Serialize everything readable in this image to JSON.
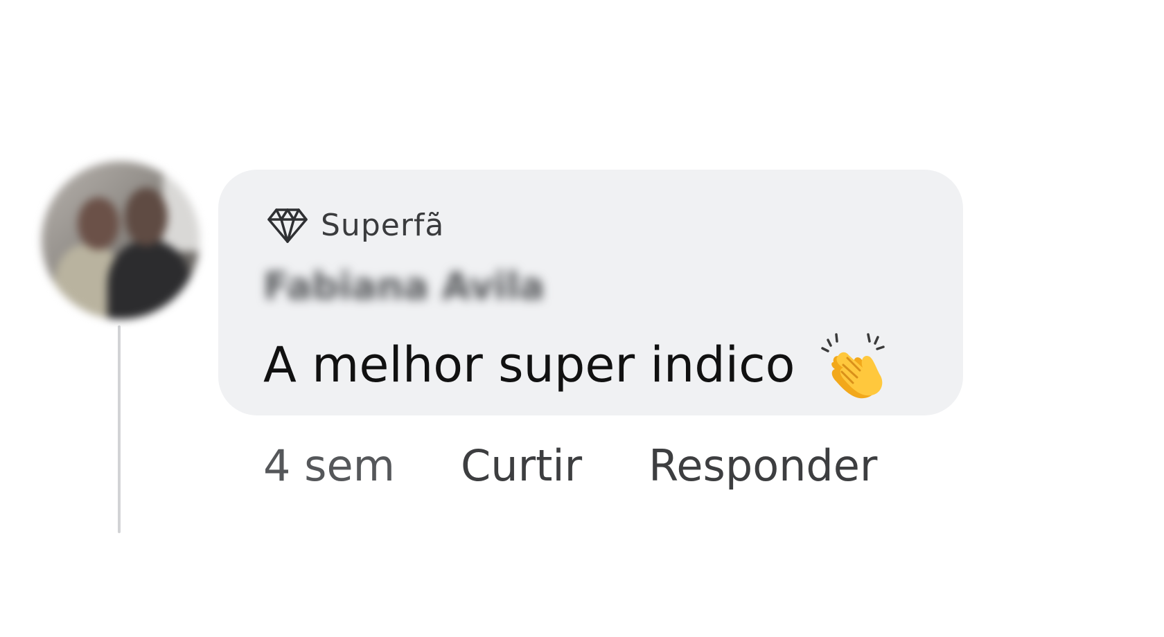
{
  "comment": {
    "badge": {
      "icon": "diamond-icon",
      "label": "Superfã"
    },
    "author": "Fabiana Avila",
    "text": "A melhor super indico",
    "emoji": "clapping-hands-icon",
    "bubble_color": "#f0f1f3"
  },
  "actions": {
    "time": "4 sem",
    "like_label": "Curtir",
    "reply_label": "Responder"
  }
}
